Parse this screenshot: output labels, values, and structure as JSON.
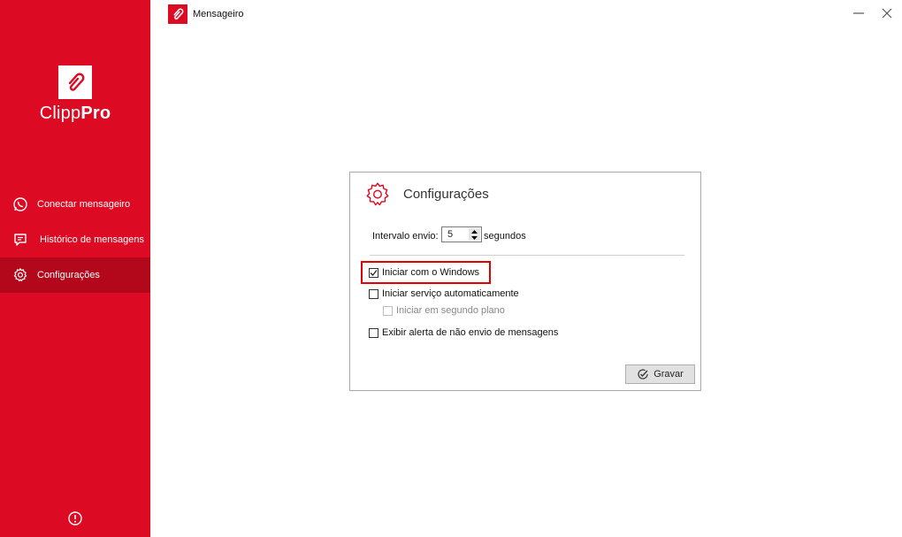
{
  "window": {
    "title": "Mensageiro"
  },
  "sidebar": {
    "brand_light": "Clipp",
    "brand_bold": "Pro",
    "items": [
      {
        "label": "Conectar mensageiro",
        "icon": "whatsapp-icon"
      },
      {
        "label": "Histórico de mensagens",
        "icon": "message-icon"
      },
      {
        "label": "Configurações",
        "icon": "gear-icon",
        "active": true
      }
    ],
    "footer_icon": "info-icon"
  },
  "settings": {
    "title": "Configurações",
    "interval_label": "Intervalo envio:",
    "interval_value": "5",
    "interval_unit": "segundos",
    "options": [
      {
        "label": "Iniciar com o Windows",
        "checked": true,
        "enabled": true
      },
      {
        "label": "Iniciar serviço automaticamente",
        "checked": false,
        "enabled": true
      },
      {
        "label": "Iniciar em segundo plano",
        "checked": false,
        "enabled": false
      },
      {
        "label": "Exibir alerta de não envio de mensagens",
        "checked": false,
        "enabled": true
      }
    ],
    "save_label": "Gravar"
  },
  "colors": {
    "brand_red": "#dc0a22",
    "active_red": "#b3071b",
    "highlight": "#e00000"
  }
}
